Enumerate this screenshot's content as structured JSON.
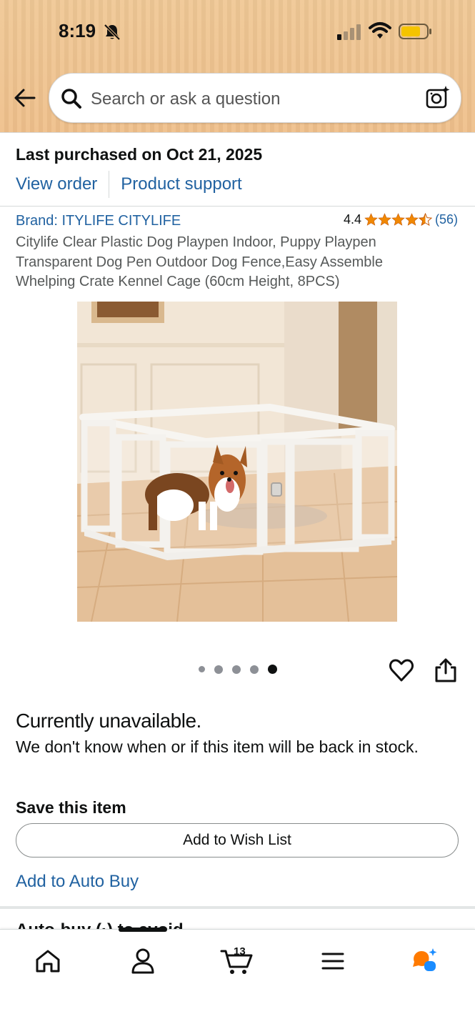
{
  "status_bar": {
    "time": "8:19"
  },
  "header": {
    "search_placeholder": "Search or ask a question"
  },
  "purchase": {
    "title": "Last purchased on Oct 21, 2025",
    "view_order": "View order",
    "product_support": "Product support"
  },
  "product": {
    "brand": "Brand: ITYLIFE CITYLIFE",
    "rating": "4.4",
    "rating_count": "(56)",
    "title": "Citylife Clear Plastic Dog Playpen Indoor, Puppy Playpen Transparent Dog Pen Outdoor Dog Fence,Easy Assemble Whelping Crate Kennel Cage (60cm Height, 8PCS)",
    "image_count": 5,
    "active_image_index": 4
  },
  "availability": {
    "title": "Currently unavailable.",
    "text": "We don't know when or if this item will be back in stock."
  },
  "save": {
    "title": "Save this item",
    "wishlist_button": "Add to Wish List",
    "auto_buy": "Add to Auto Buy"
  },
  "peek_section": {
    "text": "Auto-buy (·) to avoid"
  },
  "bottom_nav": {
    "cart_count": "13",
    "items": [
      "home-icon",
      "account-icon",
      "cart-icon",
      "menu-icon",
      "rufus-icon"
    ]
  },
  "colors": {
    "link": "#2162a1",
    "header_bg": "#efc08b",
    "star": "#f08804",
    "rufus_orange": "#ff7a00",
    "rufus_blue": "#1a8cff"
  }
}
